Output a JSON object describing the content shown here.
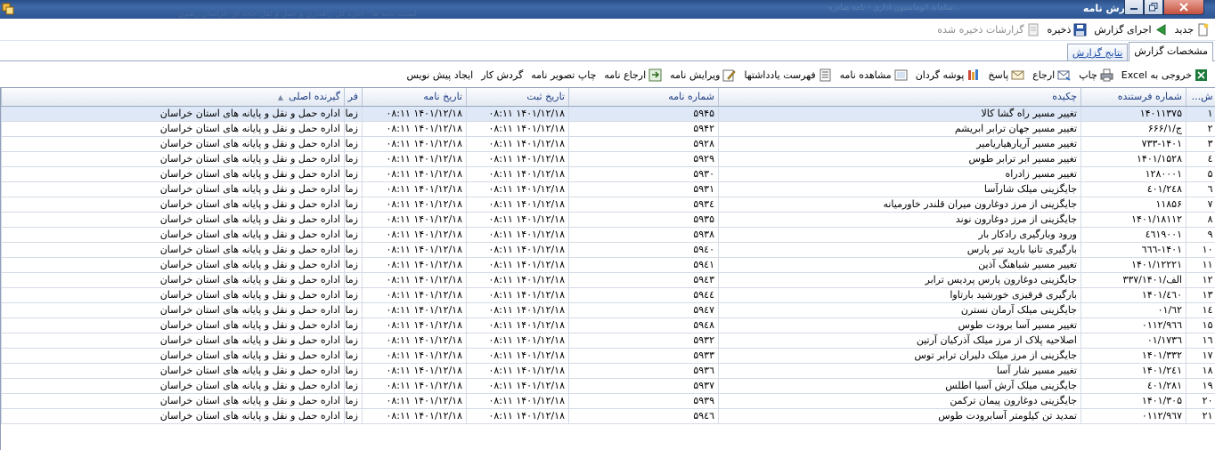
{
  "window": {
    "title": "گزارش نامه",
    "faded_text_1": "...سامانه اتوماسیون اداری - نامه صادره",
    "faded_text_2": "لیست نامه ها - اداره کل راهداری و حمل و نقل جاده ای خراسان رضوی"
  },
  "toolbar": {
    "new_label": "جدید",
    "run_label": "اجرای گزارش",
    "save_label": "ذخیره",
    "saved_label": "گزارشات ذخیره شده"
  },
  "tabs": [
    {
      "label": "مشخصات گزارش"
    },
    {
      "label": "نتایج گزارش"
    }
  ],
  "actions": {
    "excel": "خروجی به Excel",
    "print": "چاپ",
    "refer": "ارجاع",
    "reply": "پاسخ",
    "folder": "پوشه گردان",
    "view": "مشاهده نامه",
    "notes": "فهرست یادداشتها",
    "edit": "ویرایش نامه",
    "refer_letter": "ارجاع نامه",
    "print_image": "چاپ تصویر نامه",
    "workflow": "گردش کار",
    "draft": "ایجاد پیش نویس"
  },
  "columns": {
    "row": "ش...",
    "sender_no": "شماره فرستنده",
    "summary": "چکیده",
    "letter_no": "شماره نامه",
    "reg_date": "تاریخ ثبت",
    "letter_date": "تاریخ نامه",
    "from": "فر",
    "receiver": "گیرنده اصلی"
  },
  "rows": [
    {
      "n": "۱",
      "sender": "۱۴۰۱۱۳۷۵",
      "summary": "تغییر مسیر راه گشا کالا",
      "no": "۵۹۴۵",
      "reg": "۰۸:۱۱ ۱۴۰۱/۱۲/۱۸",
      "date": "۰۸:۱۱ ۱۴۰۱/۱۲/۱۸",
      "from": "زما",
      "receiver": "اداره حمل و نقل و پایانه های استان خراسان"
    },
    {
      "n": "۲",
      "sender": "۶۶۶/۱/ج",
      "summary": "تغییر مسیر جهان ترابر ابریشم",
      "no": "۵۹۴۲",
      "reg": "۰۸:۱۱ ۱۴۰۱/۱۲/۱۸",
      "date": "۰۸:۱۱ ۱۴۰۱/۱۲/۱۸",
      "from": "زما",
      "receiver": "اداره حمل و نقل و پایانه های استان خراسان"
    },
    {
      "n": "۳",
      "sender": "۷۳۳-۱۴۰۱",
      "summary": "تغییر مسیر آریارهیاریامیر",
      "no": "۵۹۲۸",
      "reg": "۰۸:۱۱ ۱۴۰۱/۱۲/۱۸",
      "date": "۰۸:۱۱ ۱۴۰۱/۱۲/۱۸",
      "from": "زما",
      "receiver": "اداره حمل و نقل و پایانه های استان خراسان"
    },
    {
      "n": "٤",
      "sender": "۱۴۰۱/۱۵۲۸",
      "summary": "تغییر مسیر ابر ترابر طوس",
      "no": "۵۹۲۹",
      "reg": "۰۸:۱۱ ۱۴۰۱/۱۲/۱۸",
      "date": "۰۸:۱۱ ۱۴۰۱/۱۲/۱۸",
      "from": "زما",
      "receiver": "اداره حمل و نقل و پایانه های استان خراسان"
    },
    {
      "n": "۵",
      "sender": "۱۲۸۰۰۰۱",
      "summary": "تغییر مسیر زادراه",
      "no": "۵۹۳۰",
      "reg": "۰۸:۱۱ ۱۴۰۱/۱۲/۱۸",
      "date": "۰۸:۱۱ ۱۴۰۱/۱۲/۱۸",
      "from": "زما",
      "receiver": "اداره حمل و نقل و پایانه های استان خراسان"
    },
    {
      "n": "٦",
      "sender": "٤۰۱/۲٤۸",
      "summary": "جایگزینی میلک شارآسا",
      "no": "۵۹۳۱",
      "reg": "۰۸:۱۱ ۱۴۰۱/۱۲/۱۸",
      "date": "۰۸:۱۱ ۱۴۰۱/۱۲/۱۸",
      "from": "زما",
      "receiver": "اداره حمل و نقل و پایانه های استان خراسان"
    },
    {
      "n": "۷",
      "sender": "۱۱۸۵۶",
      "summary": "جایگزینی از مرز دوغارون میران قلندر خاورمیانه",
      "no": "۵۹۳٤",
      "reg": "۰۸:۱۱ ۱۴۰۱/۱۲/۱۸",
      "date": "۰۸:۱۱ ۱۴۰۱/۱۲/۱۸",
      "from": "زما",
      "receiver": "اداره حمل و نقل و پایانه های استان خراسان"
    },
    {
      "n": "۸",
      "sender": "۱۴۰۱/۱۸۱۱۲",
      "summary": "جایگزینی از مرز دوغارون نوند",
      "no": "۵۹۳۵",
      "reg": "۰۸:۱۱ ۱۴۰۱/۱۲/۱۸",
      "date": "۰۸:۱۱ ۱۴۰۱/۱۲/۱۸",
      "from": "زما",
      "receiver": "اداره حمل و نقل و پایانه های استان خراسان"
    },
    {
      "n": "۹",
      "sender": "٤٦۱۹۰۰۱",
      "summary": "ورود وبارگیری رادکار بار",
      "no": "۵۹۳۸",
      "reg": "۰۸:۱۱ ۱۴۰۱/۱۲/۱۸",
      "date": "۰۸:۱۱ ۱۴۰۱/۱۲/۱۸",
      "from": "زما",
      "receiver": "اداره حمل و نقل و پایانه های استان خراسان"
    },
    {
      "n": "۱۰",
      "sender": "٦٦٦-۱۴۰۱",
      "summary": "بارگیری تانیا بارید تیر پارس",
      "no": "۵۹٤۰",
      "reg": "۰۸:۱۱ ۱۴۰۱/۱۲/۱۸",
      "date": "۰۸:۱۱ ۱۴۰۱/۱۲/۱۸",
      "from": "زما",
      "receiver": "اداره حمل و نقل و پایانه های استان خراسان"
    },
    {
      "n": "۱۱",
      "sender": "۱۴۰۱/۱۲۲۲۱",
      "summary": "تغییر مسیر شباهنگ آذین",
      "no": "۵۹٤۱",
      "reg": "۰۸:۱۱ ۱۴۰۱/۱۲/۱۸",
      "date": "۰۸:۱۱ ۱۴۰۱/۱۲/۱۸",
      "from": "زما",
      "receiver": "اداره حمل و نقل و پایانه های استان خراسان"
    },
    {
      "n": "۱۲",
      "sender": "۳۳۷/الف/۱۴۰۱",
      "summary": "جایگزینی دوغارون پارس پردیس ترابر",
      "no": "۵۹٤۳",
      "reg": "۰۸:۱۱ ۱۴۰۱/۱۲/۱۸",
      "date": "۰۸:۱۱ ۱۴۰۱/۱۲/۱۸",
      "from": "زما",
      "receiver": "اداره حمل و نقل و پایانه های استان خراسان"
    },
    {
      "n": "۱۳",
      "sender": "۱۴۰۱/٤٦۰",
      "summary": "بارگیری فرقیزی خورشید بارتاوا",
      "no": "۵۹٤٤",
      "reg": "۰۸:۱۱ ۱۴۰۱/۱۲/۱۸",
      "date": "۰۸:۱۱ ۱۴۰۱/۱۲/۱۸",
      "from": "زما",
      "receiver": "اداره حمل و نقل و پایانه های استان خراسان"
    },
    {
      "n": "١٤",
      "sender": "۰۱/٦۲",
      "summary": "جایگزینی میلک آرمان نسترن",
      "no": "۵۹٤۷",
      "reg": "۰۸:۱۱ ۱۴۰۱/۱۲/۱۸",
      "date": "۰۸:۱۱ ۱۴۰۱/۱۲/۱۸",
      "from": "زما",
      "receiver": "اداره حمل و نقل و پایانه های استان خراسان"
    },
    {
      "n": "۱۵",
      "sender": "۰۱۱۲/۹٦٦",
      "summary": "تغییر مسیر آسا برودت طوس",
      "no": "۵۹٤۸",
      "reg": "۰۸:۱۱ ۱۴۰۱/۱۲/۱۸",
      "date": "۰۸:۱۱ ۱۴۰۱/۱۲/۱۸",
      "from": "زما",
      "receiver": "اداره حمل و نقل و پایانه های استان خراسان"
    },
    {
      "n": "١٦",
      "sender": "۰۱/۱۷۳٦",
      "summary": "اصلاحیه پلاک از مرز میلک آذرکیان آرتین",
      "no": "۵۹۳۲",
      "reg": "۰۸:۱۱ ۱۴۰۱/۱۲/۱۸",
      "date": "۰۸:۱۱ ۱۴۰۱/۱۲/۱۸",
      "from": "زما",
      "receiver": "اداره حمل و نقل و پایانه های استان خراسان"
    },
    {
      "n": "۱۷",
      "sender": "۱۴۰۱/۳۳۲",
      "summary": "جایگزینی از مرز میلک دلیران ترابر توس",
      "no": "۵۹۳۳",
      "reg": "۰۸:۱۱ ۱۴۰۱/۱۲/۱۸",
      "date": "۰۸:۱۱ ۱۴۰۱/۱۲/۱۸",
      "from": "زما",
      "receiver": "اداره حمل و نقل و پایانه های استان خراسان"
    },
    {
      "n": "۱۸",
      "sender": "۱۴۰۱/۲٤۱",
      "summary": "تغییر مسیر شار آسا",
      "no": "۵۹۳٦",
      "reg": "۰۸:۱۱ ۱۴۰۱/۱۲/۱۸",
      "date": "۰۸:۱۱ ۱۴۰۱/۱۲/۱۸",
      "from": "زما",
      "receiver": "اداره حمل و نقل و پایانه های استان خراسان"
    },
    {
      "n": "۱۹",
      "sender": "٤۰۱/۲۸۱",
      "summary": "جایگزینی میلک آرش آسیا اطلس",
      "no": "۵۹۳۷",
      "reg": "۰۸:۱۱ ۱۴۰۱/۱۲/۱۸",
      "date": "۰۸:۱۱ ۱۴۰۱/۱۲/۱۸",
      "from": "زما",
      "receiver": "اداره حمل و نقل و پایانه های استان خراسان"
    },
    {
      "n": "۲۰",
      "sender": "۱۴۰۱/۳۰۵",
      "summary": "جایگزینی دوغارون پیمان ترکمن",
      "no": "۵۹۳۹",
      "reg": "۰۸:۱۱ ۱۴۰۱/۱۲/۱۸",
      "date": "۰۸:۱۱ ۱۴۰۱/۱۲/۱۸",
      "from": "زما",
      "receiver": "اداره حمل و نقل و پایانه های استان خراسان"
    },
    {
      "n": "۲۱",
      "sender": "۰۱۱۲/۹٦۷",
      "summary": "تمدید تن کیلومتر آسابرودت طوس",
      "no": "۵۹٤٦",
      "reg": "۰۸:۱۱ ۱۴۰۱/۱۲/۱۸",
      "date": "۰۸:۱۱ ۱۴۰۱/۱۲/۱۸",
      "from": "زما",
      "receiver": "اداره حمل و نقل و پایانه های استان خراسان"
    }
  ],
  "colors": {
    "titlebar": "#3f6aa8",
    "header_text": "#1f3f86",
    "selected_row": "#dfe8f7",
    "grid_line": "#d4dbe6"
  }
}
